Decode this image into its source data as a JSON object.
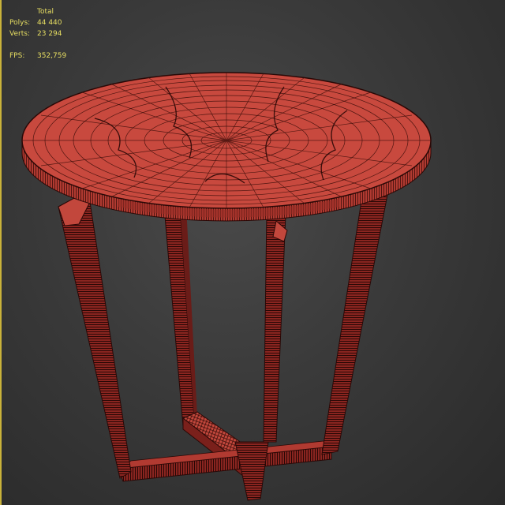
{
  "stats": {
    "header": "Total",
    "polys_label": "Polys:",
    "polys_value": "44 440",
    "verts_label": "Verts:",
    "verts_value": "23 294",
    "fps_label": "FPS:",
    "fps_value": "352,759"
  },
  "colors": {
    "stats_text": "#e8df62",
    "viewport_border": "#c9b23a",
    "mesh_fill": "#c2473c",
    "mesh_dark": "#7a201b",
    "wire": "#2a0806"
  }
}
